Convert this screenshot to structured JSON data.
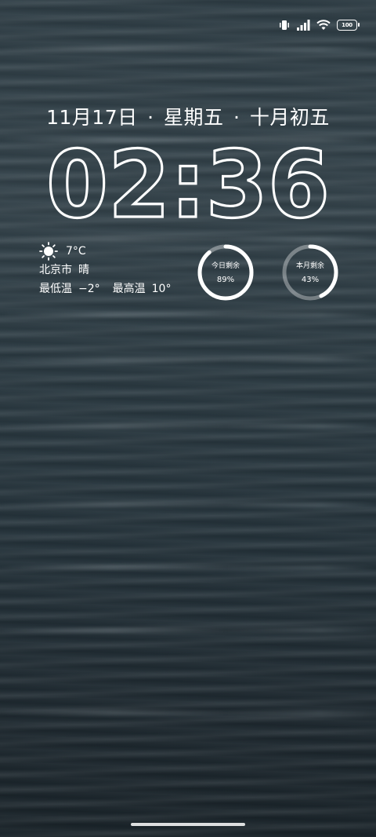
{
  "status_bar": {
    "icons": [
      "vibrate-icon",
      "signal-icon",
      "wifi-icon",
      "battery-icon"
    ],
    "battery_level": "100"
  },
  "date": {
    "month_day": "11月17日",
    "separator": "·",
    "weekday": "星期五",
    "lunar": "十月初五"
  },
  "clock": {
    "time": "02:36"
  },
  "weather": {
    "icon": "sun-icon",
    "temperature": "7°C",
    "city": "北京市",
    "condition": "晴",
    "low_label": "最低温",
    "low_value": "−2°",
    "high_label": "最高温",
    "high_value": "10°"
  },
  "rings": [
    {
      "label": "今日剩余",
      "value": "89%",
      "fraction": 0.89
    },
    {
      "label": "本月剩余",
      "value": "43%",
      "fraction": 0.43
    }
  ]
}
